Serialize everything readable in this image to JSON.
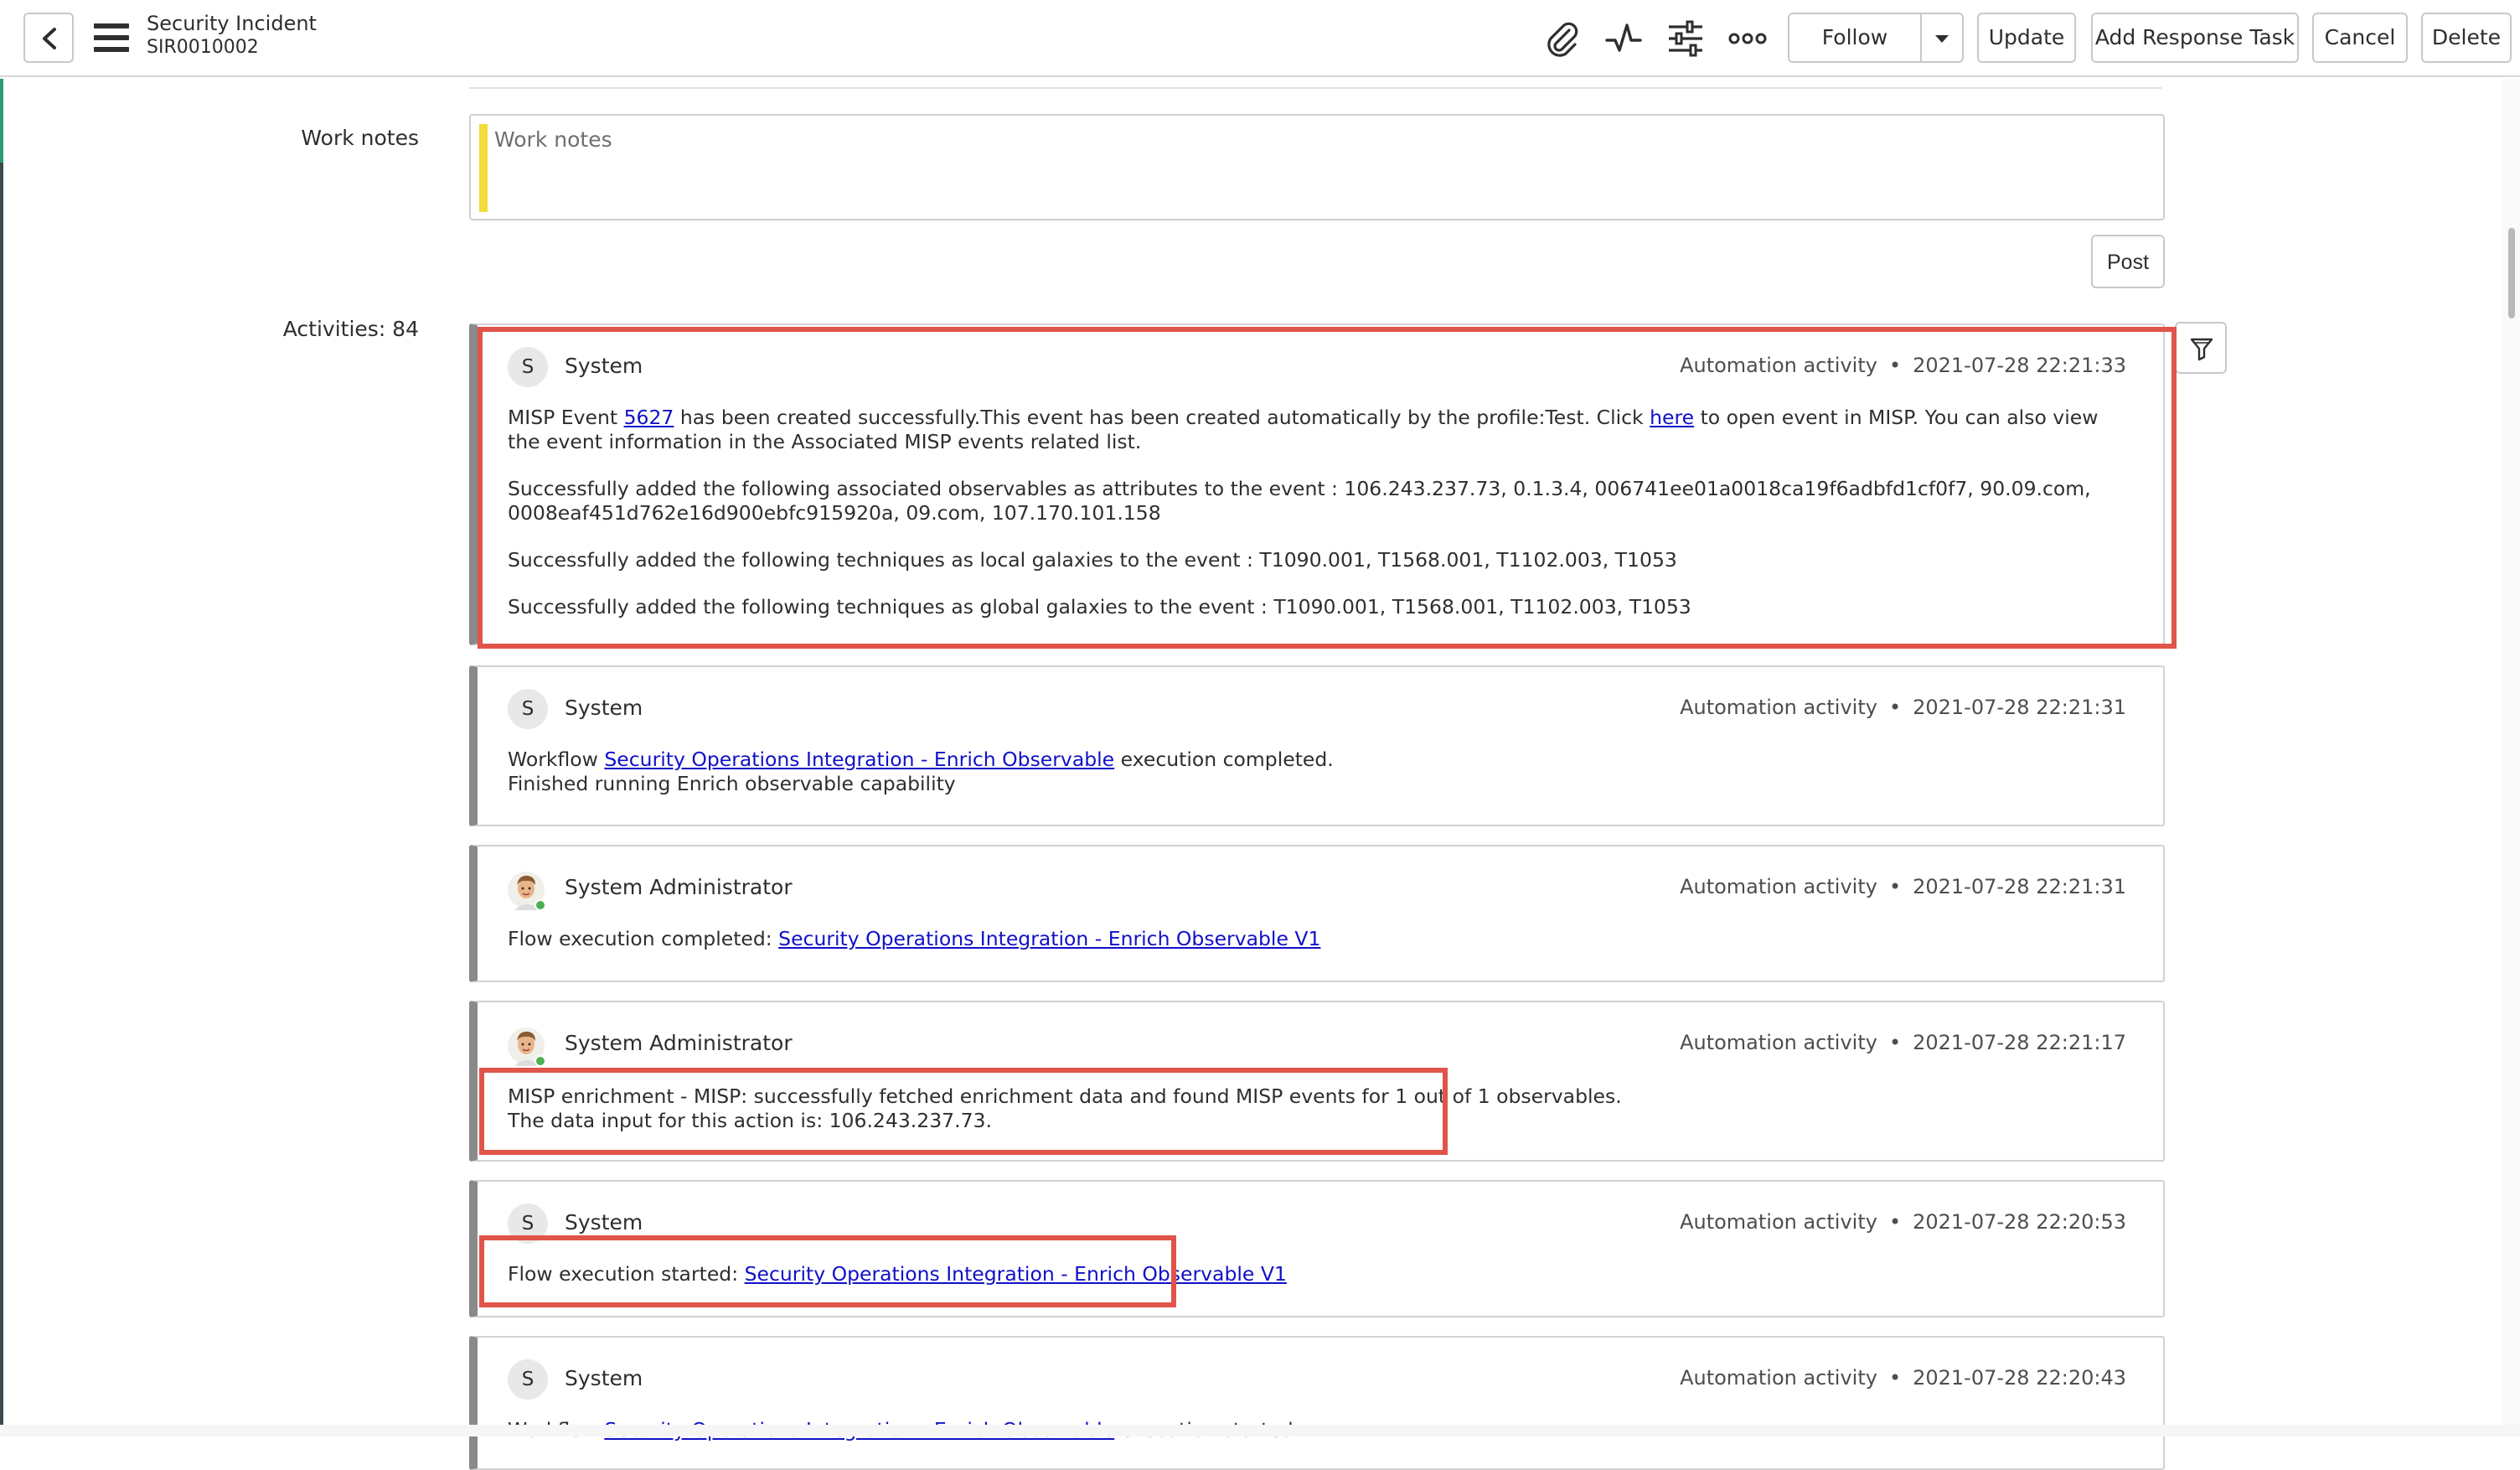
{
  "header": {
    "title": "Security Incident",
    "number": "SIR0010002",
    "icons": [
      "back-icon",
      "menu-icon",
      "paperclip-icon",
      "activity-icon",
      "settings-sliders-icon",
      "more-icon",
      "chevron-down-icon"
    ],
    "buttons": {
      "follow": "Follow",
      "update": "Update",
      "add_response_task": "Add Response Task",
      "cancel": "Cancel",
      "delete": "Delete"
    }
  },
  "work_notes": {
    "label": "Work notes",
    "placeholder": "Work notes",
    "post_label": "Post"
  },
  "activities": {
    "label": "Activities: 84",
    "items": [
      {
        "author": "System",
        "avatar_letter": "S",
        "type": "Automation activity",
        "timestamp": "2021-07-28 22:21:33",
        "p1_a": "MISP Event ",
        "p1_link1": "5627",
        "p1_b": " has been created successfully.This event has been created automatically by the profile:Test. Click ",
        "p1_link2": "here",
        "p1_c": " to open event in MISP. You can also view the event information in the Associated MISP events related list.",
        "p2": "Successfully added the following associated observables as attributes to the event : 106.243.237.73, 0.1.3.4, 006741ee01a0018ca19f6adbfd1cf0f7, 90.09.com, 0008eaf451d762e16d900ebfc915920a, 09.com, 107.170.101.158",
        "p3": "Successfully added the following techniques as local galaxies to the event : T1090.001, T1568.001, T1102.003, T1053",
        "p4": "Successfully added the following techniques as global galaxies to the event : T1090.001, T1568.001, T1102.003, T1053"
      },
      {
        "author": "System",
        "avatar_letter": "S",
        "type": "Automation activity",
        "timestamp": "2021-07-28 22:21:31",
        "line1_a": "Workflow ",
        "line1_link": "Security Operations Integration - Enrich Observable",
        "line1_b": " execution completed.",
        "line2": "Finished running Enrich observable capability"
      },
      {
        "author": "System Administrator",
        "type": "Automation activity",
        "timestamp": "2021-07-28 22:21:31",
        "line1_a": "Flow execution completed: ",
        "line1_link": "Security Operations Integration - Enrich Observable V1"
      },
      {
        "author": "System Administrator",
        "type": "Automation activity",
        "timestamp": "2021-07-28 22:21:17",
        "line1": "MISP enrichment - MISP: successfully fetched enrichment data and found MISP events for 1 out of 1 observables.",
        "line2": "The data input for this action is: 106.243.237.73."
      },
      {
        "author": "System",
        "avatar_letter": "S",
        "type": "Automation activity",
        "timestamp": "2021-07-28 22:20:53",
        "line1_a": "Flow execution started: ",
        "line1_link": "Security Operations Integration - Enrich Observable V1"
      },
      {
        "author": "System",
        "avatar_letter": "S",
        "type": "Automation activity",
        "timestamp": "2021-07-28 22:20:43",
        "line1_a": "Workflow ",
        "line1_link": "Security Operations Integration - Enrich Observable",
        "line1_b": " execution started."
      }
    ]
  },
  "colors": {
    "highlight": "#e0544a",
    "link": "#1010c8",
    "mandatory": "#f2dc3a",
    "card_accent": "#8a8a8a"
  }
}
